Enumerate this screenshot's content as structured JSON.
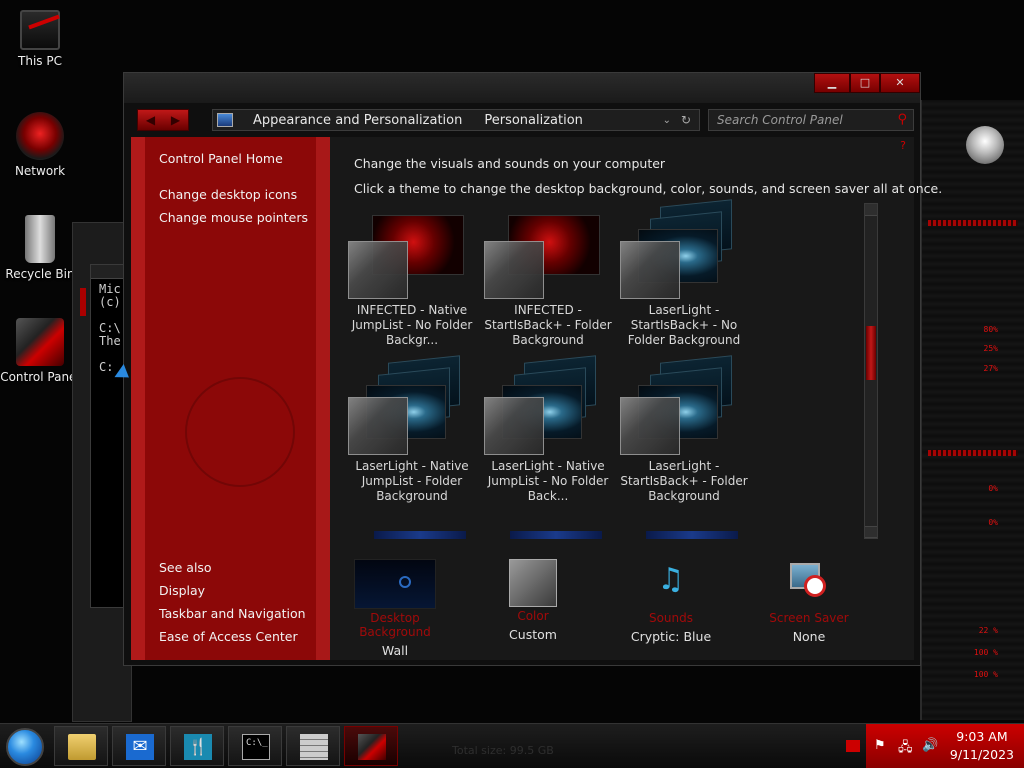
{
  "desktop": {
    "icons": [
      {
        "label": "This PC"
      },
      {
        "label": "Network"
      },
      {
        "label": "Recycle Bin"
      },
      {
        "label": "Control Panel"
      }
    ]
  },
  "cmd": {
    "lines": [
      "Mic",
      "(c)",
      "",
      "C:\\",
      "The",
      "",
      "C:"
    ]
  },
  "window": {
    "breadcrumb": [
      "Appearance and Personalization",
      "Personalization"
    ],
    "search_placeholder": "Search Control Panel",
    "sidebar": {
      "home": "Control Panel Home",
      "links": [
        "Change desktop icons",
        "Change mouse pointers"
      ],
      "see_also_title": "See also",
      "see_also": [
        "Display",
        "Taskbar and Navigation",
        "Ease of Access Center"
      ]
    },
    "heading": "Change the visuals and sounds on your computer",
    "subheading": "Click a theme to change the desktop background, color, sounds, and screen saver all at once.",
    "themes": [
      {
        "label": "INFECTED - Native JumpList - No Folder Backgr...",
        "style": "red"
      },
      {
        "label": "INFECTED - StartIsBack+ - Folder Background",
        "style": "red"
      },
      {
        "label": "LaserLight - StartIsBack+ - No Folder Background",
        "style": "blue"
      },
      {
        "label": "LaserLight - Native JumpList - Folder Background",
        "style": "blue"
      },
      {
        "label": "LaserLight - Native JumpList - No Folder Back...",
        "style": "blue"
      },
      {
        "label": "LaserLight - StartIsBack+ - Folder Background",
        "style": "blue"
      }
    ],
    "bottom": [
      {
        "title": "Desktop Background",
        "value": "Wall",
        "icon": "desktop-background-icon"
      },
      {
        "title": "Color",
        "value": "Custom",
        "icon": "color-swatch-icon"
      },
      {
        "title": "Sounds",
        "value": "Cryptic: Blue",
        "icon": "music-notes-icon"
      },
      {
        "title": "Screen Saver",
        "value": "None",
        "icon": "screen-saver-icon"
      }
    ]
  },
  "widget": {
    "values": [
      "80%",
      "25%",
      "27%",
      "0%",
      "0%",
      "22 %",
      "100 %",
      "100 %"
    ]
  },
  "taskbar": {
    "total_size": "Total size:    99.5 GB",
    "time": "9:03 AM",
    "date": "9/11/2023"
  },
  "colors": {
    "accent": "#a00a0a",
    "sidebar": "#8c0808",
    "tray": "#c00000"
  }
}
